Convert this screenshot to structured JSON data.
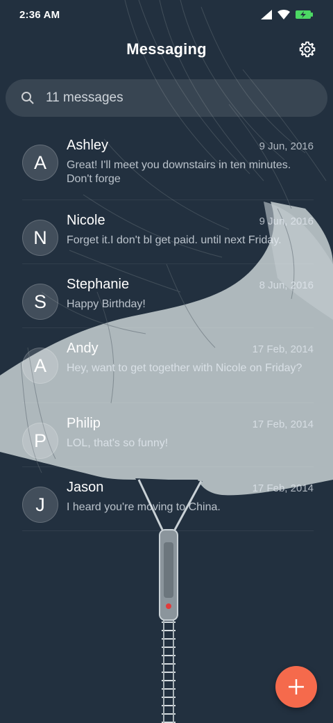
{
  "status": {
    "time": "2:36 AM"
  },
  "header": {
    "title": "Messaging"
  },
  "search": {
    "placeholder": "11 messages"
  },
  "conversations": [
    {
      "initial": "A",
      "name": "Ashley",
      "date": "9 Jun, 2016",
      "preview": "Great! I'll meet you downstairs in ten minutes. Don't forge"
    },
    {
      "initial": "N",
      "name": "Nicole",
      "date": "9 Jun, 2016",
      "preview": "Forget it.I don't bl get paid. until next Friday."
    },
    {
      "initial": "S",
      "name": "Stephanie",
      "date": "8 Jun, 2016",
      "preview": "Happy Birthday!"
    },
    {
      "initial": "A",
      "name": "Andy",
      "date": "17 Feb, 2014",
      "preview": "Hey, want to get together with Nicole on Friday?"
    },
    {
      "initial": "P",
      "name": "Philip",
      "date": "17 Feb, 2014",
      "preview": "LOL, that's so funny!"
    },
    {
      "initial": "J",
      "name": "Jason",
      "date": "17 Feb, 2014",
      "preview": "I heard you're moving to China."
    }
  ],
  "colors": {
    "background": "#22303f",
    "accent": "#f56a4c",
    "battery": "#4cd964"
  },
  "icons": [
    "signal-icon",
    "wifi-icon",
    "battery-charging-icon",
    "gear-icon",
    "search-icon",
    "plus-icon"
  ]
}
